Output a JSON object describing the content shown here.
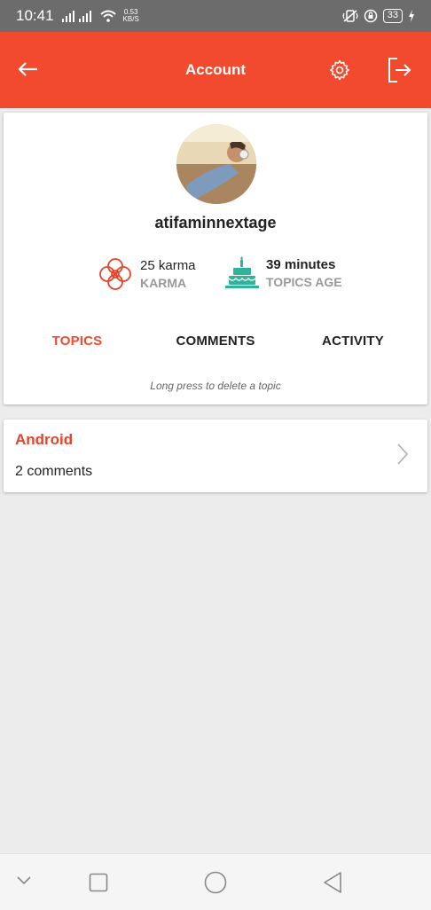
{
  "status_bar": {
    "time": "10:41",
    "speed_value": "0.53",
    "speed_unit": "KB/S",
    "battery": "33"
  },
  "app_bar": {
    "title": "Account"
  },
  "profile": {
    "username": "atifaminnextage",
    "karma_value": "25 karma",
    "karma_label": "KARMA",
    "age_value": "39 minutes",
    "age_label": "TOPICS AGE"
  },
  "tabs": [
    {
      "label": "TOPICS",
      "active": true
    },
    {
      "label": "COMMENTS",
      "active": false
    },
    {
      "label": "ACTIVITY",
      "active": false
    }
  ],
  "hint": "Long press to delete a topic",
  "topics": [
    {
      "name": "Android",
      "comments": "2 comments"
    }
  ],
  "colors": {
    "accent": "#f14a2e",
    "teal": "#2fb39a",
    "background": "#ececec"
  },
  "icons": {
    "back": "arrow-left-icon",
    "settings": "gear-icon",
    "logout": "logout-icon",
    "karma": "flower-icon",
    "age": "cake-icon",
    "chevron": "chevron-right-icon"
  }
}
